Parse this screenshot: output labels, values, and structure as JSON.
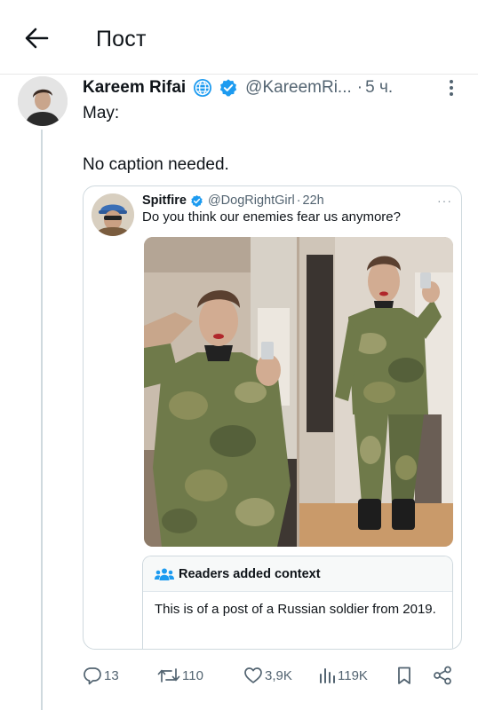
{
  "header": {
    "title": "Пост"
  },
  "tweet": {
    "author_name": "Kareem Rifai",
    "handle": "@KareemRi...",
    "dot": "·",
    "time": "5 ч.",
    "body_line1": "May:",
    "body_line2": "No caption needed."
  },
  "quote": {
    "author_name": "Spitfire",
    "handle": "@DogRightGirl",
    "dot": "·",
    "time": "22h",
    "more": "···",
    "text": "Do you think our enemies fear us anymore?",
    "context": {
      "title": "Readers added context",
      "body": "This is of a post of a Russian soldier from 2019."
    }
  },
  "actions": {
    "replies": "13",
    "reposts": "110",
    "likes": "3,9K",
    "views": "119K"
  },
  "icons": [
    "back-arrow-icon",
    "globe-icon",
    "verified-badge-icon",
    "more-vertical-icon",
    "readers-icon",
    "reply-icon",
    "repost-icon",
    "like-icon",
    "views-icon",
    "bookmark-icon",
    "share-icon"
  ],
  "colors": {
    "verified_blue": "#1d9bf0",
    "secondary_text": "#536471",
    "border": "#cfd9de"
  }
}
